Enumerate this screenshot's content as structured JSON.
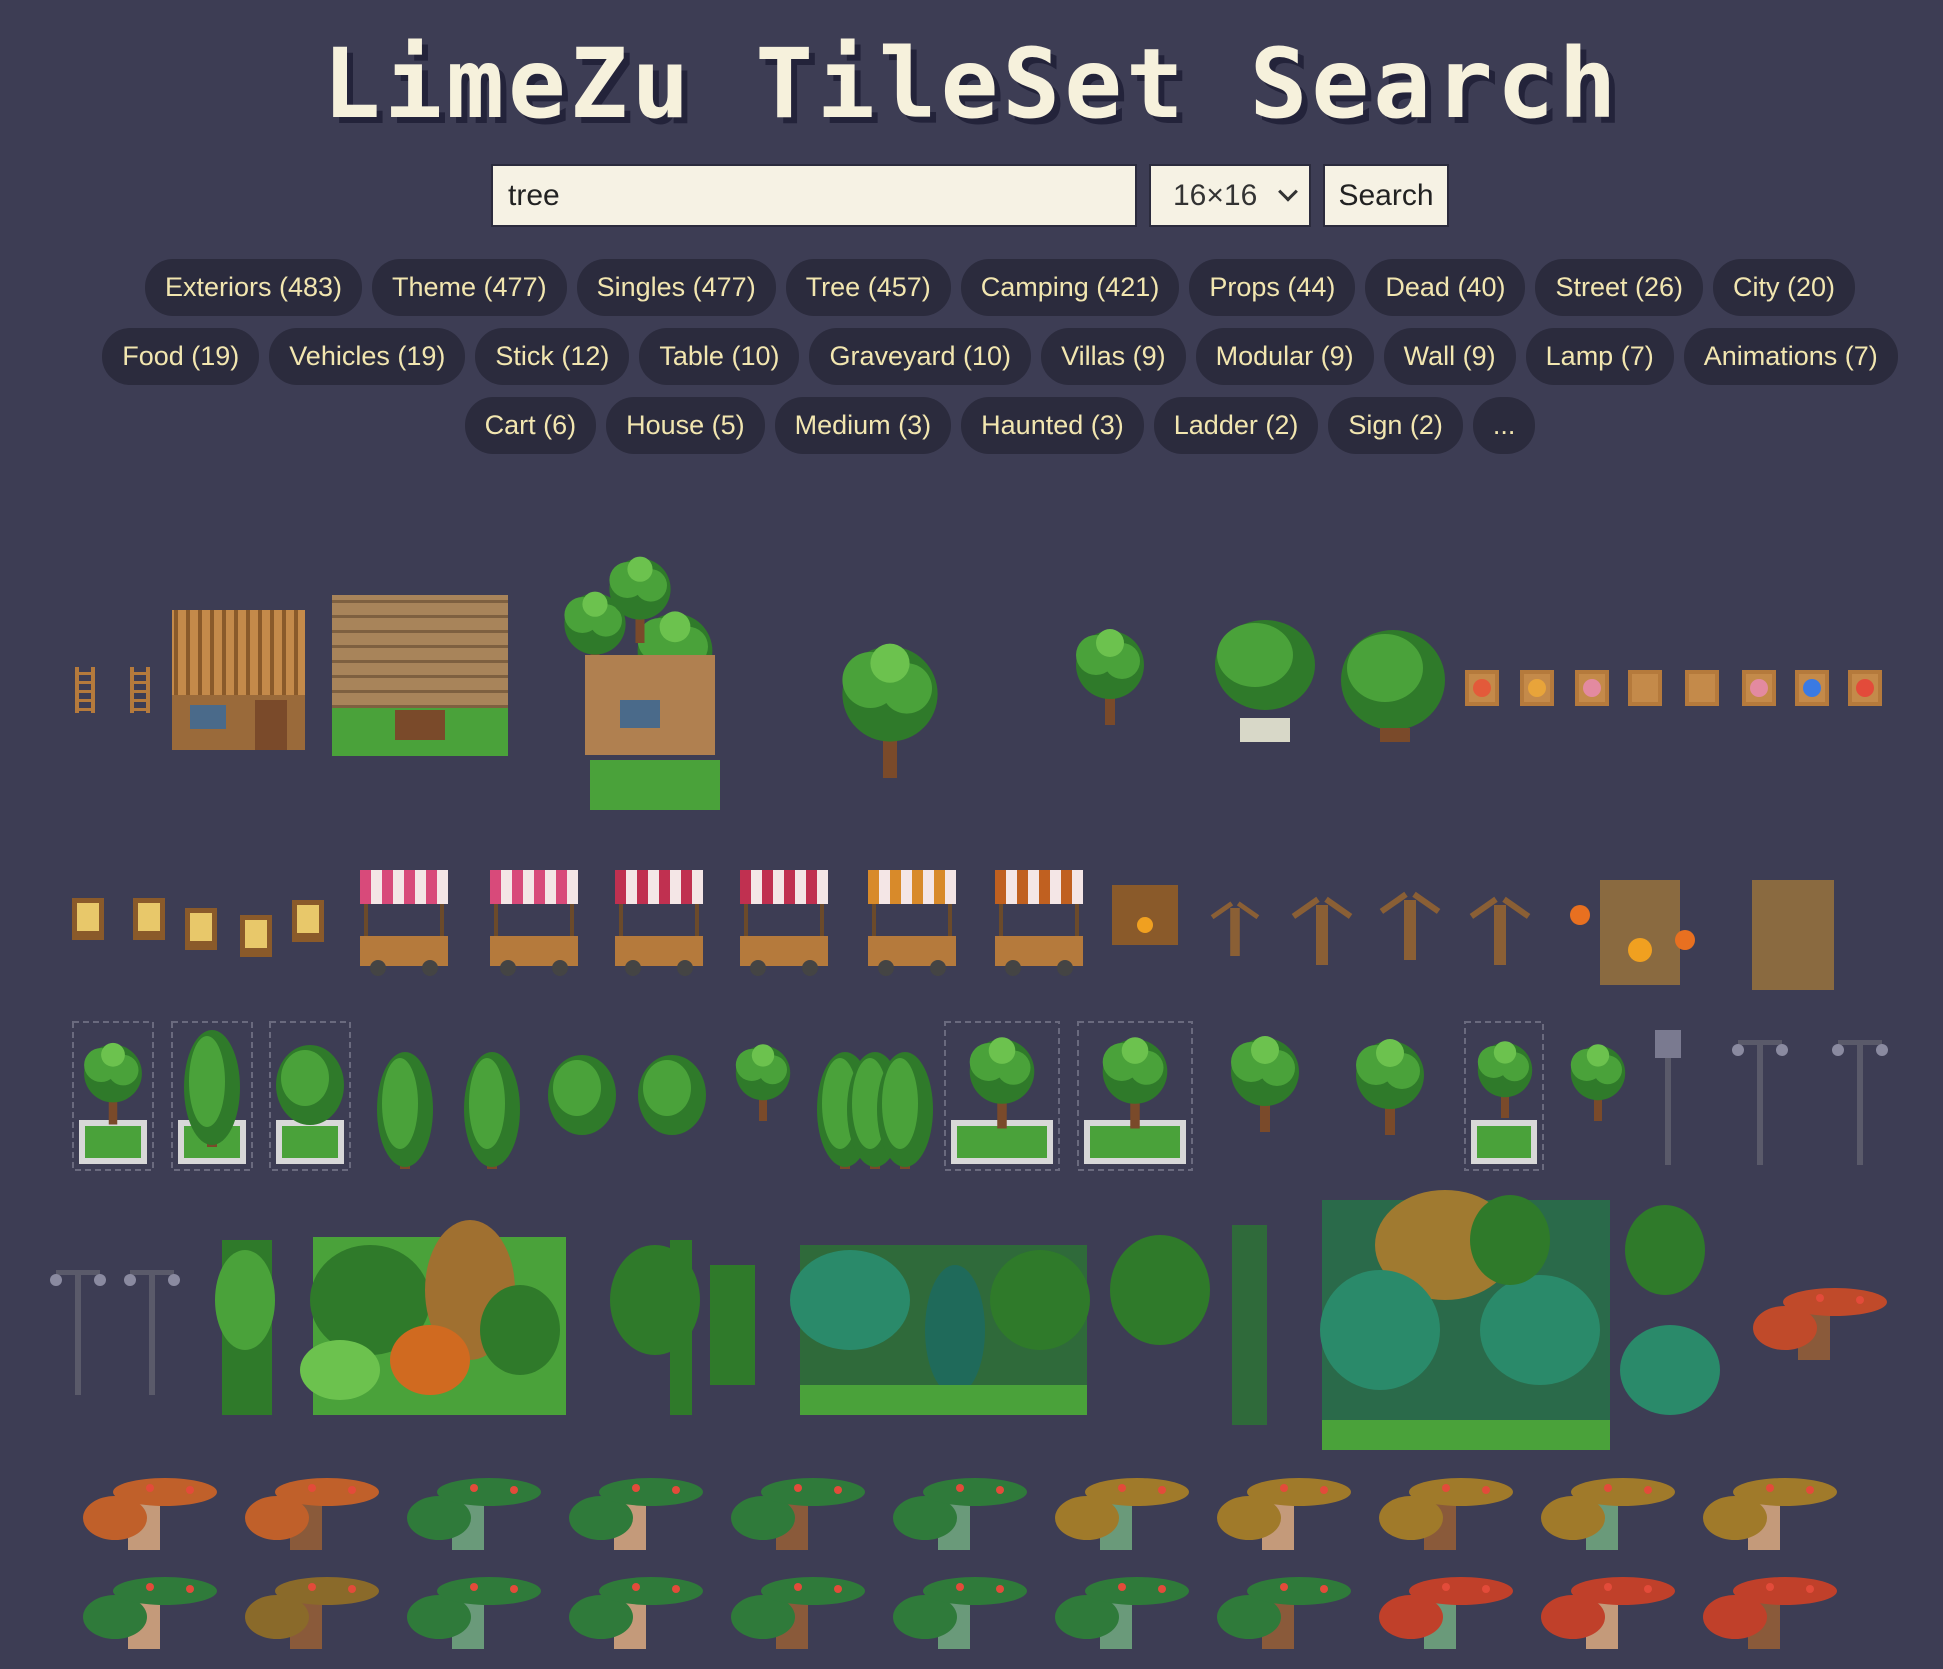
{
  "header": {
    "title": "LimeZu TileSet Search"
  },
  "search": {
    "value": "tree",
    "size_option": "16×16",
    "button_label": "Search"
  },
  "tags": [
    "Exteriors (483)",
    "Theme (477)",
    "Singles (477)",
    "Tree (457)",
    "Camping (421)",
    "Props (44)",
    "Dead (40)",
    "Street (26)",
    "City (20)",
    "Food (19)",
    "Vehicles (19)",
    "Stick (12)",
    "Table (10)",
    "Graveyard (10)",
    "Villas (9)",
    "Modular (9)",
    "Wall (9)",
    "Lamp (7)",
    "Animations (7)",
    "Cart (6)",
    "House (5)",
    "Medium (3)",
    "Haunted (3)",
    "Ladder (2)",
    "Sign (2)",
    "..."
  ],
  "results_icon": "tile-sprite-icon",
  "colors": {
    "background": "#3d3d54",
    "tag_bg": "#2b2b3d",
    "tag_text": "#f2e6b0",
    "title": "#f6f1dc"
  }
}
